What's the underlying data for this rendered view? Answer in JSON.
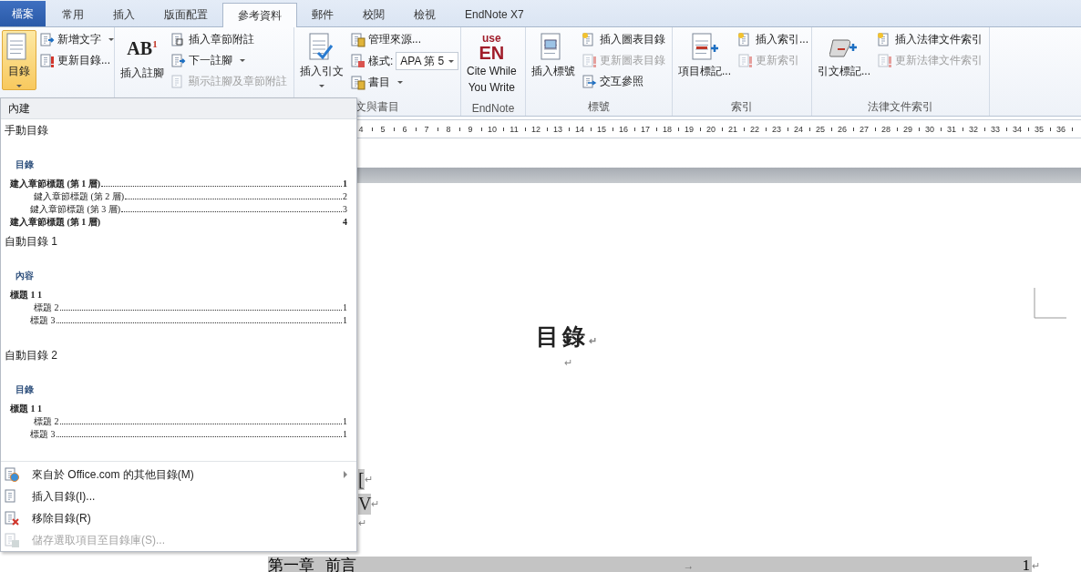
{
  "tabs": [
    {
      "label": "檔案",
      "kind": "file",
      "selected": false
    },
    {
      "label": "常用",
      "kind": "tab",
      "selected": false
    },
    {
      "label": "插入",
      "kind": "tab",
      "selected": false
    },
    {
      "label": "版面配置",
      "kind": "tab",
      "selected": false
    },
    {
      "label": "參考資料",
      "kind": "tab",
      "selected": true
    },
    {
      "label": "郵件",
      "kind": "tab",
      "selected": false
    },
    {
      "label": "校閱",
      "kind": "tab",
      "selected": false
    },
    {
      "label": "檢視",
      "kind": "tab",
      "selected": false
    },
    {
      "label": "EndNote X7",
      "kind": "tab",
      "selected": false
    }
  ],
  "ribbon": {
    "groups": [
      {
        "large": {
          "label": "目錄",
          "caret": true,
          "pressed": true
        },
        "small": [
          {
            "label": "新增文字",
            "caret": true,
            "disabled": false
          },
          {
            "label": "更新目錄...",
            "caret": false,
            "disabled": false
          }
        ]
      },
      {
        "large": {
          "label": "插入註腳",
          "glyph": "AB$^{1}$",
          "caret": false,
          "pressed": false
        },
        "small": [
          {
            "label": "插入章節附註",
            "caret": false,
            "disabled": false
          },
          {
            "label": "下一註腳",
            "caret": true,
            "disabled": false
          },
          {
            "label": "顯示註腳及章節附註",
            "caret": false,
            "disabled": true
          }
        ]
      },
      {
        "label": "文與書目",
        "large": {
          "label": "插入引文",
          "caret": true,
          "pressed": false
        },
        "small": [
          {
            "label": "管理來源...",
            "caret": false,
            "disabled": false
          },
          {
            "kind": "combo",
            "label": "樣式:",
            "value": "APA 第 5",
            "caret": true,
            "disabled": false
          },
          {
            "label": "書目",
            "caret": true,
            "disabled": false
          }
        ]
      },
      {
        "label": "EndNote",
        "large": {
          "kind": "logo",
          "logo_top": "use",
          "logo_main": "EN",
          "lines": [
            "Cite While",
            "You Write"
          ],
          "pressed": false
        }
      },
      {
        "label": "標號",
        "large": {
          "label": "插入標號",
          "caret": false,
          "pressed": false
        },
        "small": [
          {
            "label": "插入圖表目錄",
            "caret": false,
            "disabled": false
          },
          {
            "label": "更新圖表目錄",
            "caret": false,
            "disabled": true
          },
          {
            "label": "交互參照",
            "caret": false,
            "disabled": false
          }
        ]
      },
      {
        "label": "索引",
        "large": {
          "label": "項目標記...",
          "caret": false,
          "pressed": false
        },
        "small": [
          {
            "label": "插入索引...",
            "caret": false,
            "disabled": false
          },
          {
            "label": "更新索引",
            "caret": false,
            "disabled": true
          }
        ]
      },
      {
        "label": "法律文件索引",
        "large": {
          "label": "引文標記...",
          "caret": false,
          "pressed": false
        },
        "small": [
          {
            "label": "插入法律文件索引",
            "caret": false,
            "disabled": false
          },
          {
            "label": "更新法律文件索引",
            "caret": false,
            "disabled": true
          }
        ]
      }
    ]
  },
  "ruler": {
    "numbers": [
      "4",
      "5",
      "6",
      "7",
      "8",
      "9",
      "10",
      "11",
      "12",
      "13",
      "14",
      "15",
      "16",
      "17",
      "18",
      "19",
      "20",
      "21",
      "22",
      "23",
      "24",
      "25",
      "26",
      "27",
      "28",
      "29",
      "30",
      "31",
      "32",
      "33",
      "34",
      "35",
      "36"
    ]
  },
  "document": {
    "lines": [
      {
        "kind": "title",
        "text": "目錄",
        "mark": "↵"
      },
      {
        "kind": "empty",
        "mark": "↵"
      },
      {
        "kind": "cut",
        "text": "[",
        "mark": "↵"
      },
      {
        "kind": "cut",
        "text": "V",
        "mark": "↵"
      },
      {
        "kind": "empty-left",
        "mark": "↵"
      },
      {
        "kind": "toc",
        "text": "第一章",
        "text2": "前言",
        "tab": "→",
        "page": "1",
        "mark": "↵"
      }
    ]
  },
  "gallery": {
    "header": "內建",
    "sections": [
      {
        "title": "手動目錄",
        "heading": "目錄",
        "entries": [
          {
            "kind": "h1",
            "text": "建入章節標題 (第 1 層)",
            "leader": true,
            "page": "1"
          },
          {
            "kind": "h2",
            "text": "鍵入章節標題 (第 2 層)",
            "leader": true,
            "page": "2"
          },
          {
            "kind": "h3",
            "text": "鍵入章節標題 (第 3 層)",
            "leader": true,
            "page": "3"
          },
          {
            "kind": "h1",
            "text": "建入章節標題 (第 1 層)",
            "leader": false,
            "page": "4"
          }
        ]
      },
      {
        "title": "自動目錄 1",
        "heading": "內容",
        "entries": [
          {
            "kind": "h1",
            "text": "標題 1 1",
            "leader": false
          },
          {
            "kind": "h2",
            "text": "標題 2",
            "leader": true,
            "page": "1"
          },
          {
            "kind": "h3",
            "text": "標題 3",
            "leader": true,
            "page": "1"
          }
        ]
      },
      {
        "title": "自動目錄 2",
        "heading": "目錄",
        "entries": [
          {
            "kind": "h1",
            "text": "標題 1 1",
            "leader": false
          },
          {
            "kind": "h2",
            "text": "標題 2",
            "leader": true,
            "page": "1"
          },
          {
            "kind": "h3",
            "text": "標題 3",
            "leader": true,
            "page": "1"
          }
        ]
      }
    ],
    "menu": [
      {
        "label": "來自於 Office.com 的其他目錄(M)",
        "submenu": true,
        "disabled": false
      },
      {
        "label": "插入目錄(I)...",
        "submenu": false,
        "disabled": false
      },
      {
        "label": "移除目錄(R)",
        "submenu": false,
        "disabled": false
      },
      {
        "label": "儲存選取項目至目錄庫(S)...",
        "submenu": false,
        "disabled": true
      }
    ]
  }
}
